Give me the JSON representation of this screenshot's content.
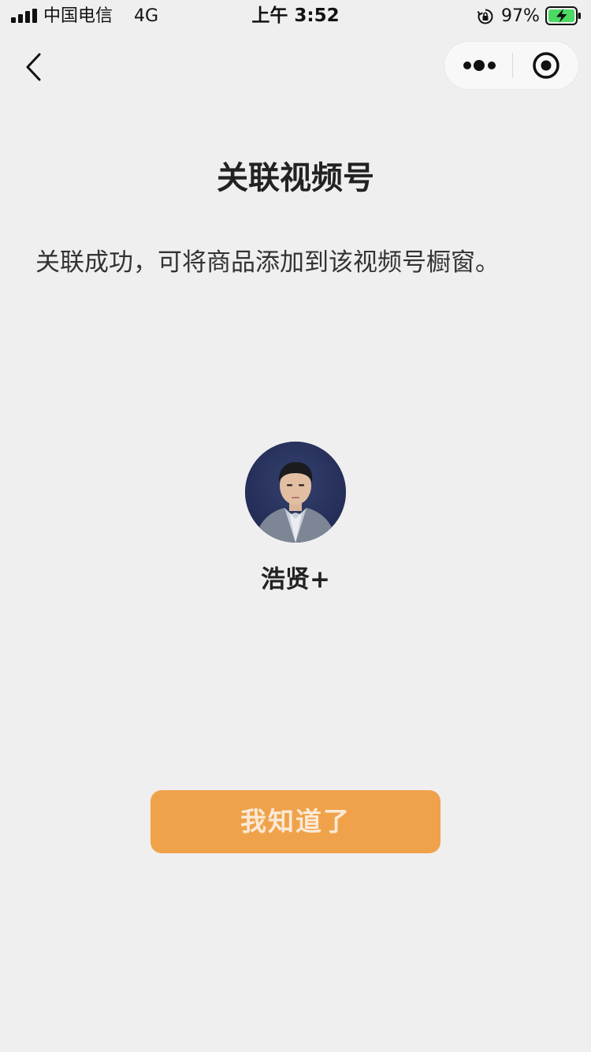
{
  "status_bar": {
    "carrier": "中国电信",
    "network": "4G",
    "time": "上午 3:52",
    "battery_percent": "97%",
    "icons": [
      "signal-icon",
      "orientation-lock-icon",
      "battery-charging-icon"
    ]
  },
  "nav": {
    "back_icon": "chevron-left-icon",
    "more_icon": "more-dots-icon",
    "close_icon": "target-close-icon"
  },
  "page": {
    "title": "关联视频号",
    "description": "关联成功，可将商品添加到该视频号橱窗。"
  },
  "channel": {
    "name": "浩贤+",
    "avatar_icon": "user-avatar"
  },
  "actions": {
    "confirm_label": "我知道了"
  },
  "colors": {
    "background": "#efefef",
    "button": "#f0a24b",
    "button_text": "#fbead6",
    "battery_charge": "#4cd964"
  }
}
